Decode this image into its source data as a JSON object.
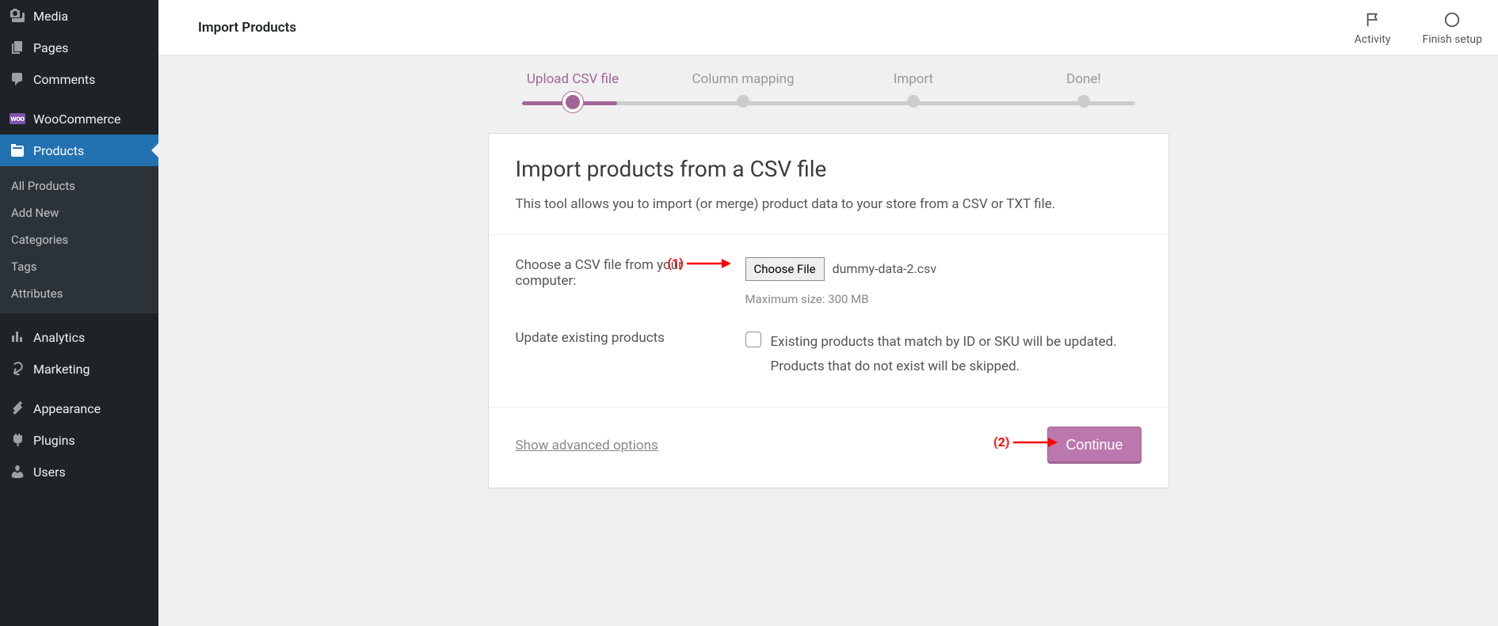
{
  "sidebar": {
    "items": [
      {
        "icon": "media",
        "label": "Media"
      },
      {
        "icon": "page",
        "label": "Pages"
      },
      {
        "icon": "comment",
        "label": "Comments"
      },
      {
        "icon": "woo",
        "label": "WooCommerce"
      },
      {
        "icon": "products",
        "label": "Products",
        "active": true
      },
      {
        "icon": "analytics",
        "label": "Analytics"
      },
      {
        "icon": "marketing",
        "label": "Marketing"
      },
      {
        "icon": "appearance",
        "label": "Appearance"
      },
      {
        "icon": "plugins",
        "label": "Plugins"
      },
      {
        "icon": "users",
        "label": "Users"
      }
    ],
    "submenu": [
      "All Products",
      "Add New",
      "Categories",
      "Tags",
      "Attributes"
    ]
  },
  "topbar": {
    "title": "Import Products",
    "activity_label": "Activity",
    "finish_label": "Finish setup"
  },
  "stepper": {
    "steps": [
      "Upload CSV file",
      "Column mapping",
      "Import",
      "Done!"
    ],
    "active_index": 0
  },
  "card": {
    "title": "Import products from a CSV file",
    "description": "This tool allows you to import (or merge) product data to your store from a CSV or TXT file.",
    "file_label": "Choose a CSV file from your computer:",
    "choose_btn": "Choose File",
    "file_name": "dummy-data-2.csv",
    "max_size": "Maximum size: 300 MB",
    "update_label": "Update existing products",
    "update_desc": "Existing products that match by ID or SKU will be updated. Products that do not exist will be skipped.",
    "adv_link": "Show advanced options",
    "continue_btn": "Continue"
  },
  "annotations": {
    "a1": "(1)",
    "a2": "(2)"
  }
}
